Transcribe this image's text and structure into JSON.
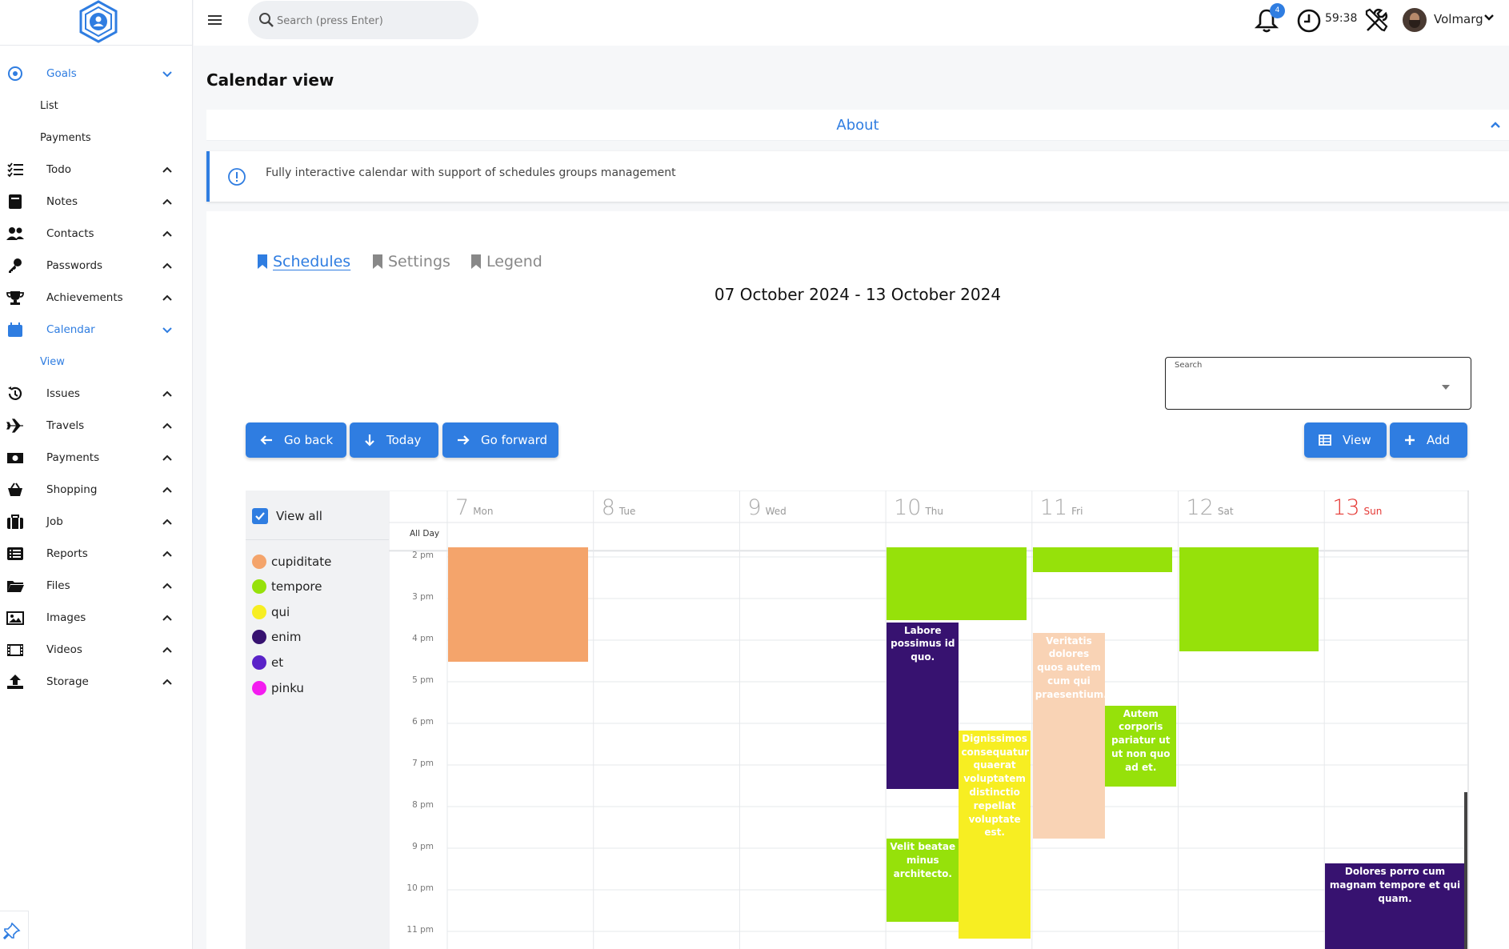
{
  "sidebar": {
    "items": [
      {
        "label": "Goals",
        "icon": "target-icon",
        "name": "goals",
        "expanded": true,
        "active": true
      },
      {
        "label": "Todo",
        "icon": "checklist-icon",
        "name": "todo"
      },
      {
        "label": "Notes",
        "icon": "notebook-icon",
        "name": "notes"
      },
      {
        "label": "Contacts",
        "icon": "users-icon",
        "name": "contacts"
      },
      {
        "label": "Passwords",
        "icon": "key-icon",
        "name": "passwords"
      },
      {
        "label": "Achievements",
        "icon": "trophy-icon",
        "name": "achievements"
      },
      {
        "label": "Calendar",
        "icon": "calendar-icon",
        "name": "calendar",
        "expanded": true,
        "active": true
      },
      {
        "label": "Issues",
        "icon": "history-icon",
        "name": "issues"
      },
      {
        "label": "Travels",
        "icon": "plane-icon",
        "name": "travels"
      },
      {
        "label": "Payments",
        "icon": "money-icon",
        "name": "payments"
      },
      {
        "label": "Shopping",
        "icon": "basket-icon",
        "name": "shopping"
      },
      {
        "label": "Job",
        "icon": "briefcase-icon",
        "name": "job"
      },
      {
        "label": "Reports",
        "icon": "list-icon",
        "name": "reports"
      },
      {
        "label": "Files",
        "icon": "folder-icon",
        "name": "files"
      },
      {
        "label": "Images",
        "icon": "image-icon",
        "name": "images"
      },
      {
        "label": "Videos",
        "icon": "film-icon",
        "name": "videos"
      },
      {
        "label": "Storage",
        "icon": "upload-icon",
        "name": "storage"
      }
    ],
    "goals_sub": [
      "List",
      "Payments"
    ],
    "calendar_sub": [
      "View"
    ]
  },
  "topbar": {
    "search_placeholder": "Search (press Enter)",
    "notification_count": "4",
    "timer": "59:38",
    "username": "Volmarg"
  },
  "page": {
    "title": "Calendar view",
    "about_title": "About",
    "info_text": "Fully interactive calendar with support of schedules groups management"
  },
  "tabs": [
    {
      "label": "Schedules",
      "active": true
    },
    {
      "label": "Settings",
      "active": false
    },
    {
      "label": "Legend",
      "active": false
    }
  ],
  "calendar": {
    "date_range": "07 October 2024 - 13 October 2024",
    "search_label": "Search",
    "buttons": {
      "go_back": "Go back",
      "today": "Today",
      "go_forward": "Go forward",
      "view": "View",
      "add": "Add"
    },
    "view_all": "View all",
    "all_day_label": "All Day",
    "legend": [
      {
        "name": "cupiditate",
        "color": "#f4a46b"
      },
      {
        "name": "tempore",
        "color": "#96e10a"
      },
      {
        "name": "qui",
        "color": "#f7ee22"
      },
      {
        "name": "enim",
        "color": "#371270"
      },
      {
        "name": "et",
        "color": "#5a22c8"
      },
      {
        "name": "pinku",
        "color": "#f41cf0"
      }
    ],
    "days": [
      {
        "num": "7",
        "name": "Mon"
      },
      {
        "num": "8",
        "name": "Tue"
      },
      {
        "num": "9",
        "name": "Wed"
      },
      {
        "num": "10",
        "name": "Thu"
      },
      {
        "num": "11",
        "name": "Fri"
      },
      {
        "num": "12",
        "name": "Sat"
      },
      {
        "num": "13",
        "name": "Sun",
        "today": true
      }
    ],
    "hours": [
      "2 pm",
      "3 pm",
      "4 pm",
      "5 pm",
      "6 pm",
      "7 pm",
      "8 pm",
      "9 pm",
      "10 pm",
      "11 pm"
    ],
    "events": [
      {
        "day": 0,
        "start": 14.0,
        "end": 16.75,
        "color": "#f4a46b",
        "title": ""
      },
      {
        "day": 3,
        "start": 14.0,
        "end": 15.75,
        "color": "#96e10a",
        "title": ""
      },
      {
        "day": 4,
        "start": 14.0,
        "end": 14.6,
        "color": "#96e10a",
        "title": ""
      },
      {
        "day": 5,
        "start": 14.0,
        "end": 16.5,
        "color": "#96e10a",
        "title": ""
      },
      {
        "day": 3,
        "start": 15.8,
        "end": 19.8,
        "color": "#371270",
        "title": "Labore possimus id quo.",
        "half": 0
      },
      {
        "day": 4,
        "start": 16.05,
        "end": 21.0,
        "color": "#f9d3b5",
        "title": "Veritatis dolores quos autem cum qui praesentium.",
        "half": 0
      },
      {
        "day": 4,
        "start": 17.8,
        "end": 19.75,
        "color": "#96e10a",
        "title": "Autem corporis pariatur ut ut non quo ad et.",
        "half": 1
      },
      {
        "day": 3,
        "start": 18.4,
        "end": 23.4,
        "color": "#f7ee22",
        "title": "Dignissimos consequatur quaerat voluptatem distinctio repellat voluptate est.",
        "half": 1
      },
      {
        "day": 3,
        "start": 21.0,
        "end": 23.0,
        "color": "#96e10a",
        "title": "Velit beatae minus architecto.",
        "half": 0
      },
      {
        "day": 6,
        "start": 21.6,
        "end": 24.0,
        "color": "#371270",
        "title": "Dolores porro cum magnam tempore et qui quam."
      }
    ]
  }
}
